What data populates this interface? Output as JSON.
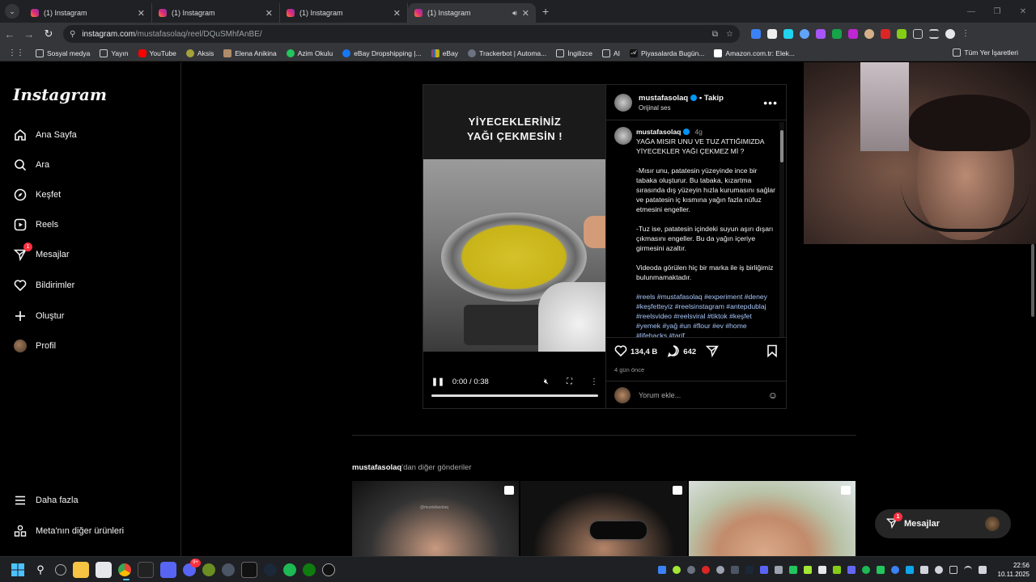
{
  "browser": {
    "tabs": [
      {
        "title": "(1) Instagram",
        "active": false
      },
      {
        "title": "(1) Instagram",
        "active": false
      },
      {
        "title": "(1) Instagram",
        "active": false
      },
      {
        "title": "(1) Instagram",
        "active": true
      }
    ],
    "url_domain": "instagram.com",
    "url_path": "/mustafasolaq/reel/DQuSMhfAnBE/",
    "bookmarks": [
      "Sosyal medya",
      "Yayın",
      "YouTube",
      "Aksis",
      "Elena Anikina",
      "Azim Okulu",
      "eBay Dropshipping |...",
      "eBay",
      "Trackerbot | Automa...",
      "İngilizce",
      "AI",
      "Piyasalarda Bugün...",
      "Amazon.com.tr: Elek..."
    ],
    "all_bookmarks": "Tüm Yer İşaretleri"
  },
  "sidebar": {
    "logo": "Instagram",
    "items": [
      {
        "label": "Ana Sayfa",
        "icon": "home-icon"
      },
      {
        "label": "Ara",
        "icon": "search-icon"
      },
      {
        "label": "Keşfet",
        "icon": "compass-icon"
      },
      {
        "label": "Reels",
        "icon": "reels-icon"
      },
      {
        "label": "Mesajlar",
        "icon": "messenger-icon",
        "badge": "1"
      },
      {
        "label": "Bildirimler",
        "icon": "heart-icon"
      },
      {
        "label": "Oluştur",
        "icon": "plus-icon"
      },
      {
        "label": "Profil",
        "icon": "avatar"
      }
    ],
    "bottom": [
      {
        "label": "Daha fazla",
        "icon": "menu-icon"
      },
      {
        "label": "Meta'nın diğer ürünleri",
        "icon": "grid-icon"
      }
    ]
  },
  "post": {
    "video_caption_line1": "YİYECEKLERİNİZ",
    "video_caption_line2": "YAĞI ÇEKMESİN !",
    "time": "0:00 / 0:38",
    "author": "mustafasolaq",
    "follow": "• Takip",
    "audio": "Orijinal ses",
    "comment_age": "4g",
    "caption_title": "YAĞA MISIR UNU VE TUZ ATTIĞIMIZDA YİYECEKLER YAĞI ÇEKMEZ Mİ ?",
    "caption_p1": "-Mısır unu, patatesin yüzeyinde ince bir tabaka oluşturur. Bu tabaka, kızartma sırasında dış yüzeyin hızla kurumasını sağlar ve patatesin iç kısmına yağın fazla nüfuz etmesini engeller.",
    "caption_p2": "-Tuz ise, patatesin içindeki suyun aşırı dışarı çıkmasını engeller. Bu da yağın içeriye girmesini azaltır.",
    "caption_p3": "Videoda görülen hiç bir marka ile iş birliğimiz bulunmamaktadır.",
    "hashtags": "#reels #mustafasolaq #experiment #deney #keşfetteyiz #reelsinstagram #antepdublaj #reelsvideo #reelsviral #tiktok #keşfet #yemek #yağ #un #flour #ev #home #lifehacks #tarif",
    "likes": "134,4 B",
    "comments": "642",
    "posted_ago": "4 gün önce",
    "comment_placeholder": "Yorum ekle..."
  },
  "more_posts": {
    "user": "mustafasolaq",
    "suffix": "'dan diğer gönderiler",
    "thumb_watermark": "@mustafasolaq"
  },
  "dm_pill": {
    "label": "Mesajlar",
    "badge": "1"
  },
  "taskbar": {
    "time": "22:56",
    "date": "10.11.2025",
    "discord_badge": "9+"
  },
  "colors": {
    "accent_blue": "#0095f6",
    "notify_red": "#ff3040",
    "hashtag": "#a8c7fa"
  }
}
